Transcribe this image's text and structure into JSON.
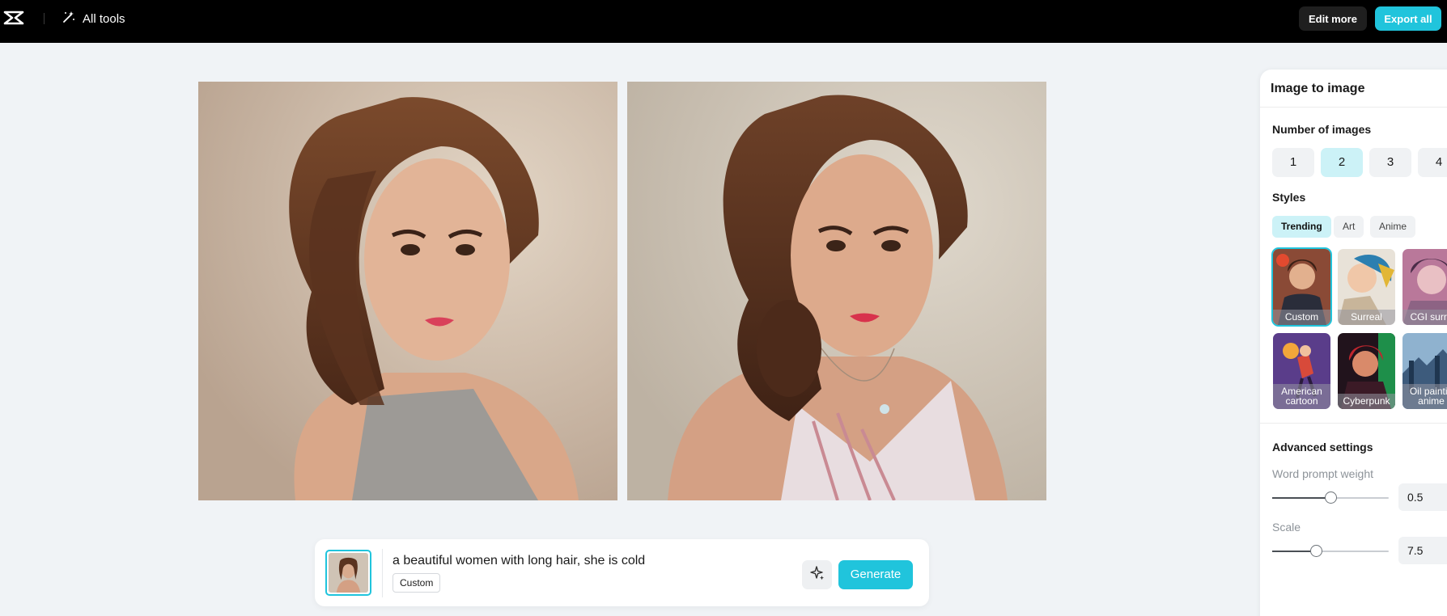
{
  "header": {
    "tools_label": "All tools",
    "edit_more_label": "Edit more",
    "export_all_label": "Export all"
  },
  "prompt_bar": {
    "prompt_text": "a beautiful women with long hair, she is cold",
    "style_chip": "Custom",
    "generate_label": "Generate"
  },
  "panel": {
    "title": "Image to image",
    "number_label": "Number of images",
    "numbers": [
      "1",
      "2",
      "3",
      "4"
    ],
    "selected_number": "2",
    "styles_label": "Styles",
    "tabs": [
      "Trending",
      "Art",
      "Anime"
    ],
    "selected_tab": "Trending",
    "styles": [
      {
        "label": "Custom",
        "selected": true
      },
      {
        "label": "Surreal",
        "selected": false
      },
      {
        "label": "CGI surre",
        "selected": false
      },
      {
        "label": "American\ncartoon",
        "selected": false
      },
      {
        "label": "Cyberpunk",
        "selected": false
      },
      {
        "label": "Oil paintin\nanime",
        "selected": false
      }
    ],
    "advanced_label": "Advanced settings",
    "word_weight_label": "Word prompt weight",
    "word_weight_value": "0.5",
    "word_weight_fraction": 0.5,
    "scale_label": "Scale",
    "scale_value": "7.5",
    "scale_fraction": 0.375
  },
  "colors": {
    "accent": "#20c4dc",
    "accent_light": "#ccf2f7",
    "topbar": "#000000",
    "canvas_bg": "#f0f3f6"
  },
  "icons": [
    "capcut-logo-icon",
    "magic-wand-icon",
    "sparkle-icon"
  ]
}
